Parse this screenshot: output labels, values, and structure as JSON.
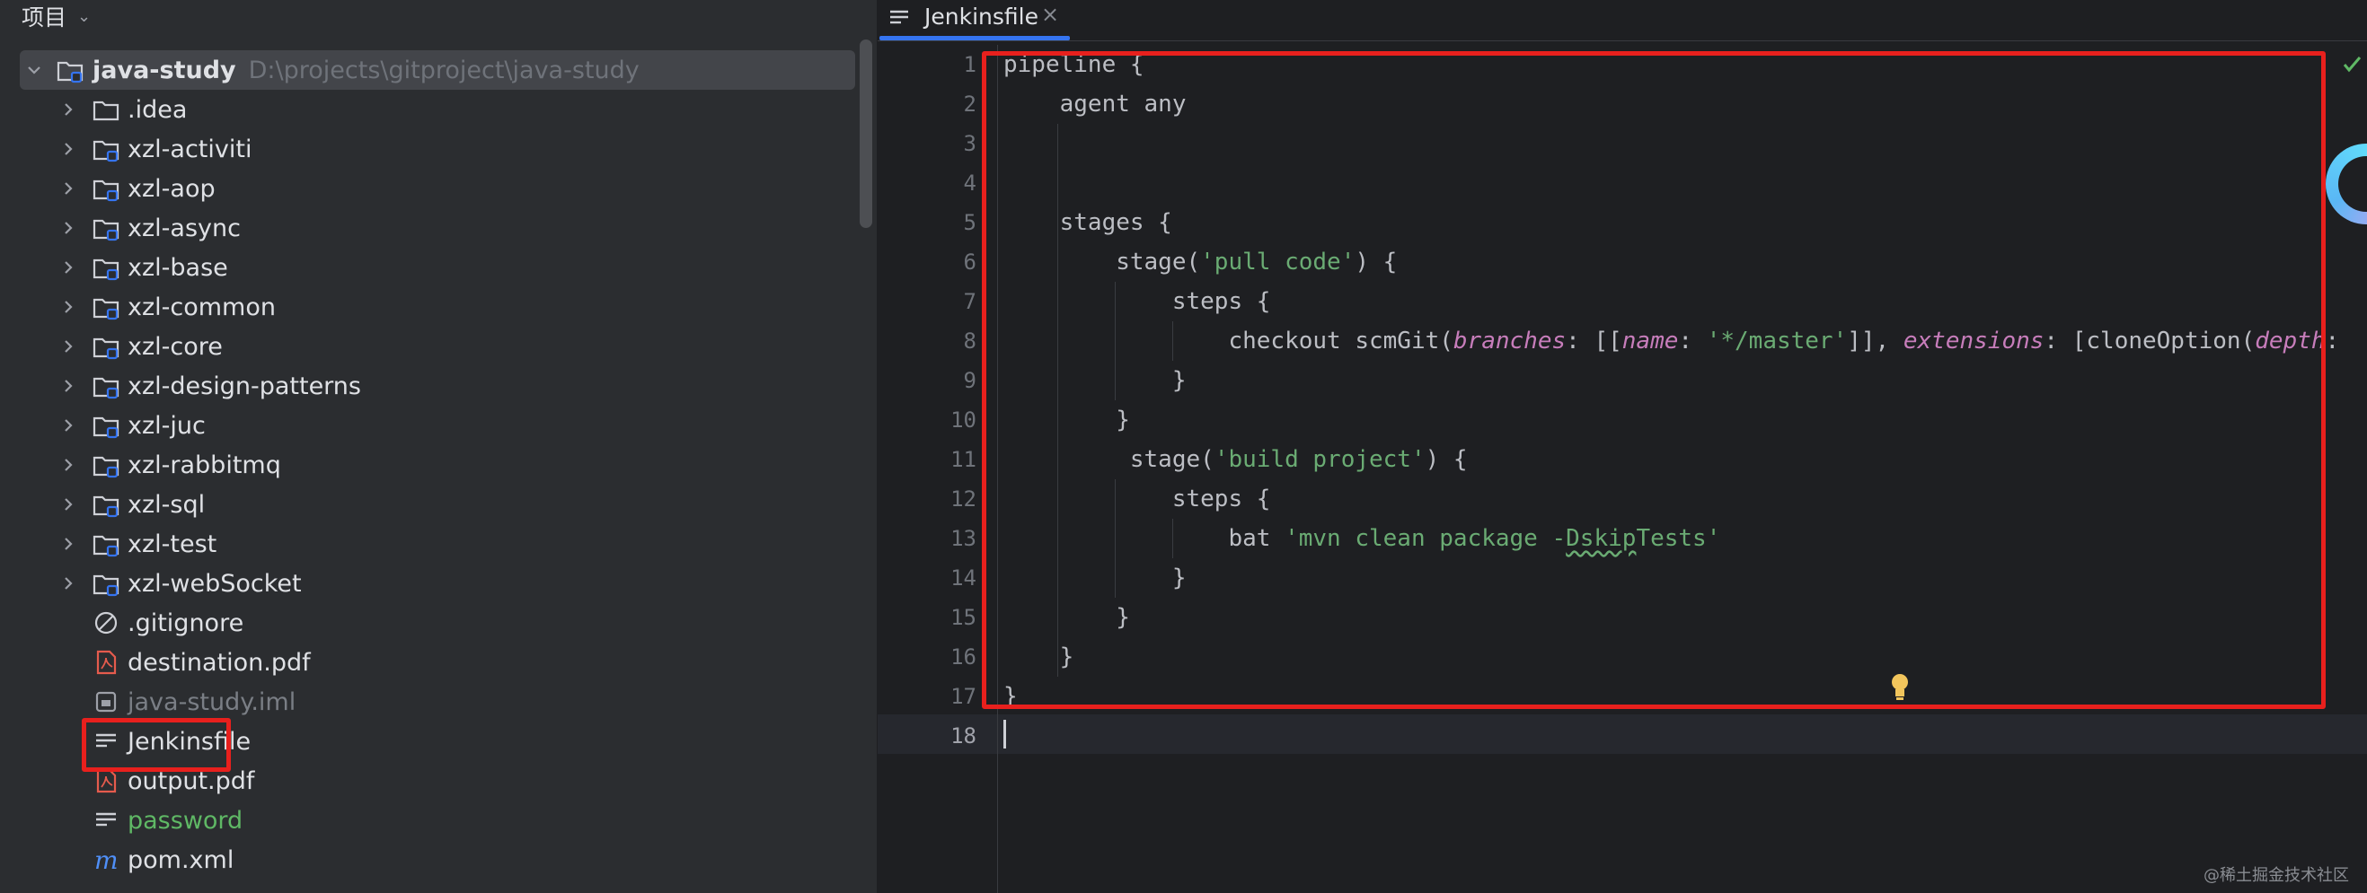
{
  "project_panel": {
    "title": "项目",
    "tree": [
      {
        "label": "java-study",
        "path": "D:\\projects\\gitproject\\java-study",
        "type": "module-folder",
        "expanded": true,
        "selected": true
      },
      {
        "label": ".idea",
        "type": "folder"
      },
      {
        "label": "xzl-activiti",
        "type": "module-folder"
      },
      {
        "label": "xzl-aop",
        "type": "module-folder"
      },
      {
        "label": "xzl-async",
        "type": "module-folder"
      },
      {
        "label": "xzl-base",
        "type": "module-folder"
      },
      {
        "label": "xzl-common",
        "type": "module-folder"
      },
      {
        "label": "xzl-core",
        "type": "module-folder"
      },
      {
        "label": "xzl-design-patterns",
        "type": "module-folder"
      },
      {
        "label": "xzl-juc",
        "type": "module-folder"
      },
      {
        "label": "xzl-rabbitmq",
        "type": "module-folder"
      },
      {
        "label": "xzl-sql",
        "type": "module-folder"
      },
      {
        "label": "xzl-test",
        "type": "module-folder"
      },
      {
        "label": "xzl-webSocket",
        "type": "module-folder"
      },
      {
        "label": ".gitignore",
        "type": "ignore-file"
      },
      {
        "label": "destination.pdf",
        "type": "pdf-file"
      },
      {
        "label": "java-study.iml",
        "type": "iml-file",
        "color": "#7a7e85"
      },
      {
        "label": "Jenkinsfile",
        "type": "text-file",
        "highlighted": true
      },
      {
        "label": "output.pdf",
        "type": "pdf-file"
      },
      {
        "label": "password",
        "type": "text-file",
        "color": "#5fb865"
      },
      {
        "label": "pom.xml",
        "type": "maven-file"
      }
    ]
  },
  "editor": {
    "tab_label": "Jenkinsfile",
    "current_line": 18,
    "lines": [
      [
        [
          "pipeline {",
          "plain"
        ]
      ],
      [
        [
          "    agent any",
          "plain"
        ]
      ],
      [
        [
          "",
          "plain"
        ]
      ],
      [
        [
          "",
          "plain"
        ]
      ],
      [
        [
          "    stages {",
          "plain"
        ]
      ],
      [
        [
          "        stage(",
          "plain"
        ],
        [
          "'pull code'",
          "str"
        ],
        [
          ") {",
          "plain"
        ]
      ],
      [
        [
          "            steps {",
          "plain"
        ]
      ],
      [
        [
          "                checkout scmGit(",
          "plain"
        ],
        [
          "branches",
          "pm"
        ],
        [
          ": [[",
          "plain"
        ],
        [
          "name",
          "pm"
        ],
        [
          ": ",
          "plain"
        ],
        [
          "'*/master'",
          "str"
        ],
        [
          "]], ",
          "plain"
        ],
        [
          "extensions",
          "pm"
        ],
        [
          ": [cloneOption(",
          "plain"
        ],
        [
          "depth",
          "pm"
        ],
        [
          ":",
          "plain"
        ]
      ],
      [
        [
          "            }",
          "plain"
        ]
      ],
      [
        [
          "        }",
          "plain"
        ]
      ],
      [
        [
          "         stage(",
          "plain"
        ],
        [
          "'build project'",
          "str"
        ],
        [
          ") {",
          "plain"
        ]
      ],
      [
        [
          "            steps {",
          "plain"
        ]
      ],
      [
        [
          "                bat ",
          "plain"
        ],
        [
          "'mvn clean package -",
          "str"
        ],
        [
          "Dskip",
          "str-squig"
        ],
        [
          "Tests'",
          "str"
        ]
      ],
      [
        [
          "            }",
          "plain"
        ]
      ],
      [
        [
          "        }",
          "plain"
        ]
      ],
      [
        [
          "    }",
          "plain"
        ]
      ],
      [
        [
          "}",
          "plain"
        ]
      ],
      [
        [
          "",
          "plain"
        ]
      ]
    ]
  },
  "watermark": "@稀土掘金技术社区",
  "colors": {
    "panel_bg": "#2b2d30",
    "editor_bg": "#1e1f22",
    "accent": "#3574f0",
    "highlight_box": "#e8201d",
    "string": "#6aab73",
    "named_param": "#c77dbb"
  }
}
